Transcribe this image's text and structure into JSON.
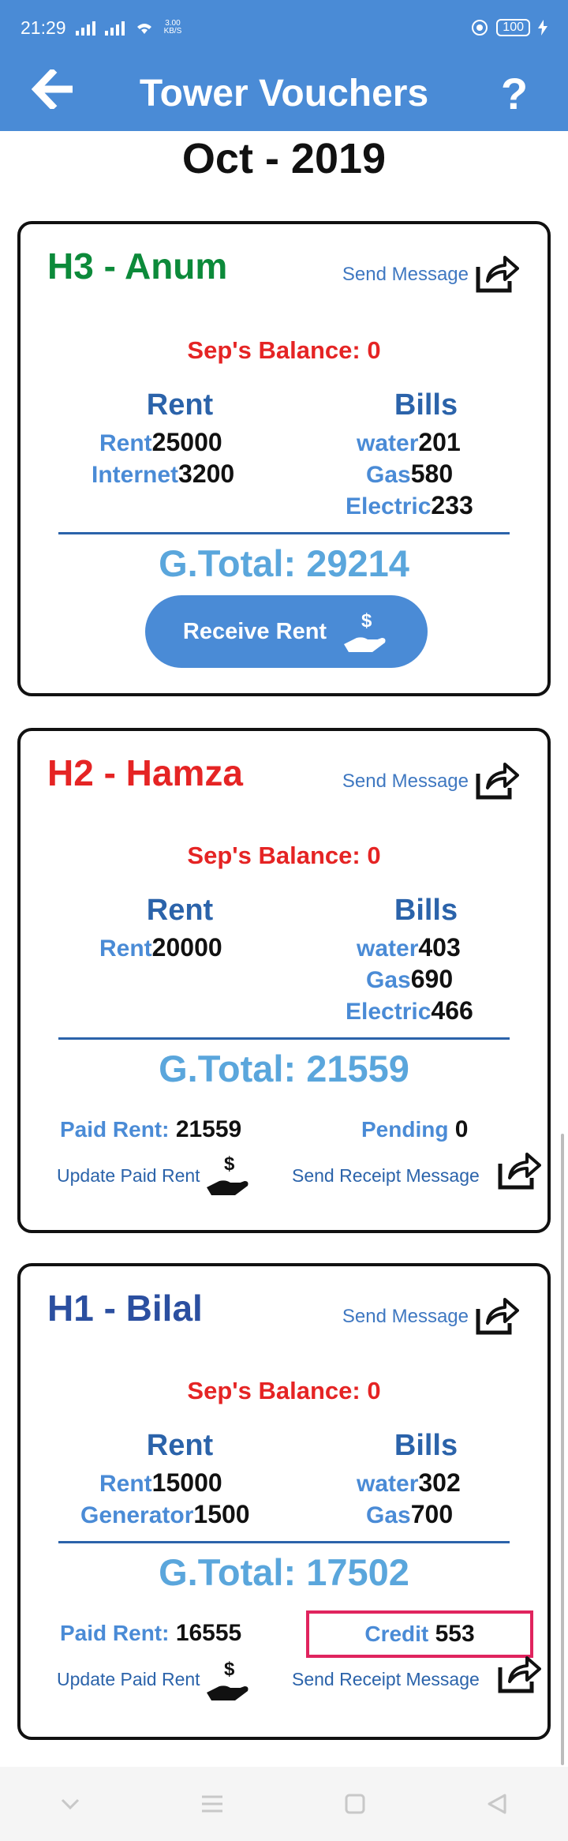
{
  "status": {
    "time": "21:29",
    "net_rate": "3.00\nKB/S",
    "battery": "100"
  },
  "appbar": {
    "title": "Tower Vouchers",
    "back_icon": "back-arrow-icon",
    "help_icon": "help-question-icon"
  },
  "month": "Oct - 2019",
  "cards": [
    {
      "name": "H3 - Anum",
      "name_color": "#0c8a3a",
      "send_message": "Send Message",
      "balance": "Sep's Balance: 0",
      "rent_header": "Rent",
      "bills_header": "Bills",
      "rent_items": [
        {
          "label": "Rent",
          "value": "25000"
        },
        {
          "label": "Internet",
          "value": "3200"
        }
      ],
      "bill_items": [
        {
          "label": "water",
          "value": "201"
        },
        {
          "label": "Gas",
          "value": "580"
        },
        {
          "label": "Electric",
          "value": "233"
        }
      ],
      "gtotal": "G.Total: 29214",
      "button": "Receive Rent"
    },
    {
      "name": "H2 - Hamza",
      "name_color": "#e52424",
      "send_message": "Send Message",
      "balance": "Sep's Balance: 0",
      "rent_header": "Rent",
      "bills_header": "Bills",
      "rent_items": [
        {
          "label": "Rent",
          "value": "20000"
        }
      ],
      "bill_items": [
        {
          "label": "water",
          "value": "403"
        },
        {
          "label": "Gas",
          "value": "690"
        },
        {
          "label": "Electric",
          "value": "466"
        }
      ],
      "gtotal": "G.Total: 21559",
      "paid_label": "Paid Rent:",
      "paid_value": "21559",
      "status_label": "Pending",
      "status_value": "0",
      "update_label": "Update Paid Rent",
      "receipt_label": "Send Receipt Message"
    },
    {
      "name": "H1 - Bilal",
      "name_color": "#2b4fa0",
      "send_message": "Send Message",
      "balance": "Sep's Balance: 0",
      "rent_header": "Rent",
      "bills_header": "Bills",
      "rent_items": [
        {
          "label": "Rent",
          "value": "15000"
        },
        {
          "label": "Generator",
          "value": "1500"
        }
      ],
      "bill_items": [
        {
          "label": "water",
          "value": "302"
        },
        {
          "label": "Gas",
          "value": "700"
        }
      ],
      "gtotal": "G.Total: 17502",
      "paid_label": "Paid Rent:",
      "paid_value": "16555",
      "status_label": "Credit",
      "status_value": "553",
      "update_label": "Update Paid Rent",
      "receipt_label": "Send Receipt Message"
    }
  ],
  "navbar": {
    "items": [
      "chevron-down-icon",
      "menu-icon",
      "home-square-icon",
      "back-triangle-icon"
    ]
  }
}
